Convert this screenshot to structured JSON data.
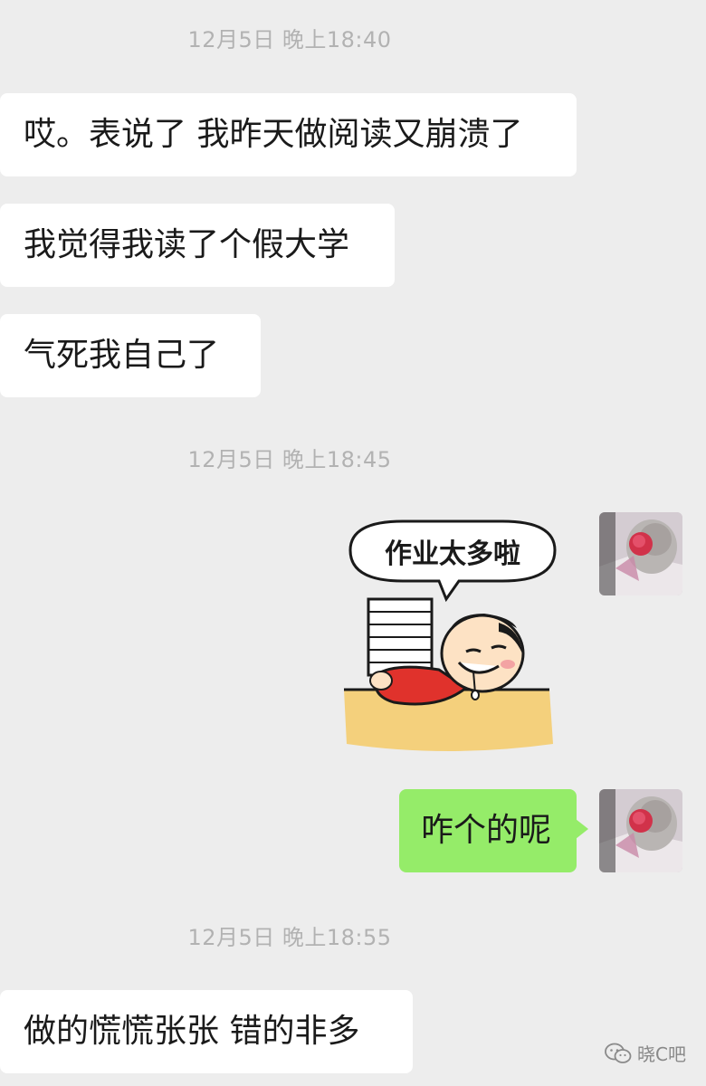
{
  "chat": {
    "groups": [
      {
        "timestamp": "12月5日 晚上18:40",
        "messages": [
          {
            "side": "left",
            "text": "哎。表说了 我昨天做阅读又崩溃了"
          },
          {
            "side": "left",
            "text": "我觉得我读了个假大学"
          },
          {
            "side": "left",
            "text": "气死我自己了"
          }
        ]
      },
      {
        "timestamp": "12月5日 晚上18:45",
        "messages": [
          {
            "side": "right",
            "type": "sticker",
            "sticker_text": "作业太多啦"
          },
          {
            "side": "right",
            "text": "咋个的呢"
          }
        ]
      },
      {
        "timestamp": "12月5日 晚上18:55",
        "messages": [
          {
            "side": "left",
            "text": "做的慌慌张张 错的非多"
          }
        ]
      }
    ]
  },
  "watermark": {
    "text": "晓C吧",
    "icon": "wechat-icon"
  },
  "colors": {
    "background": "#ededed",
    "bubble_left": "#ffffff",
    "bubble_right": "#95ec69",
    "timestamp": "#b2b2b2"
  }
}
